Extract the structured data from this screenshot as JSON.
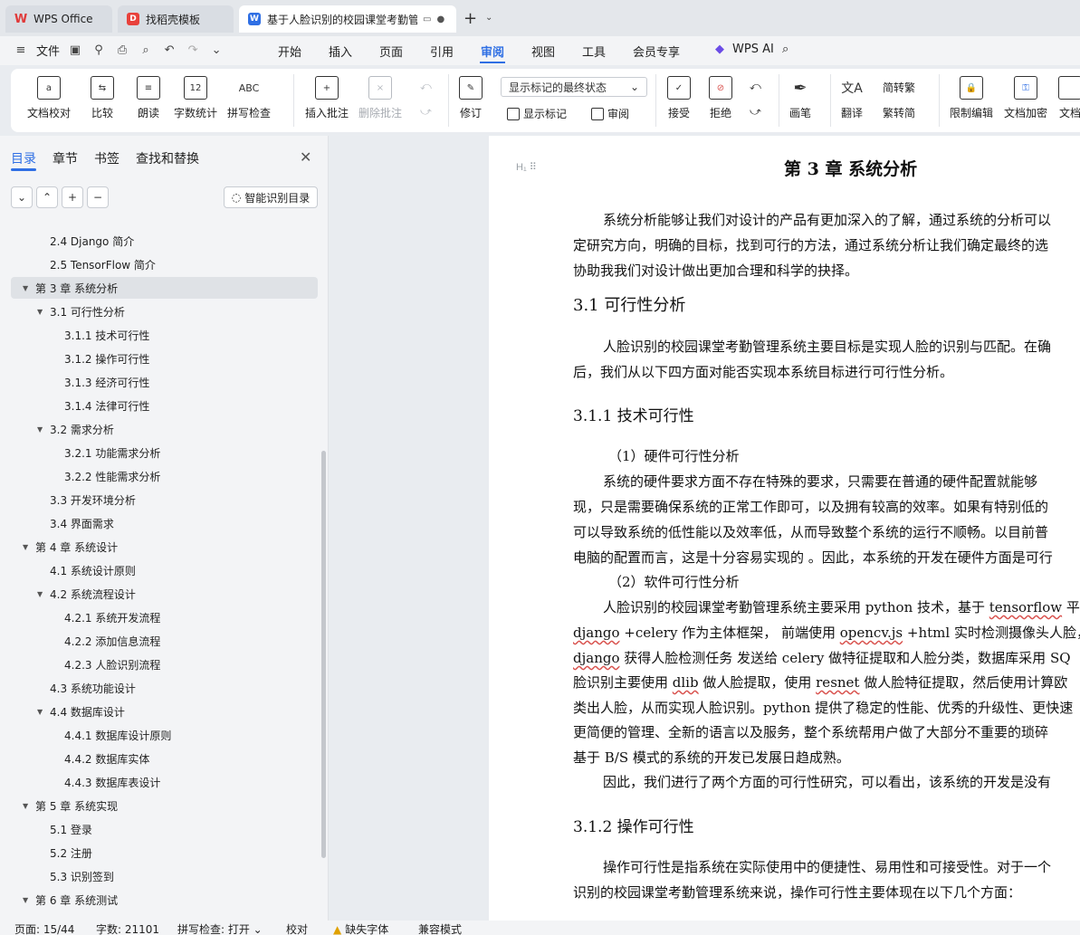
{
  "tabs": [
    {
      "label": "WPS Office",
      "icon": "wps-logo-icon"
    },
    {
      "label": "找稻壳模板",
      "icon": "daoke-icon"
    },
    {
      "label": "基于人脸识别的校园课堂考勤管理系统",
      "icon": "writer-doc-icon",
      "active": true
    }
  ],
  "menu": {
    "file_label": "文件",
    "items": [
      "开始",
      "插入",
      "页面",
      "引用",
      "审阅",
      "视图",
      "工具",
      "会员专享"
    ],
    "active": "审阅",
    "wps_ai_label": "WPS AI"
  },
  "ribbon": {
    "doc_check": "文档校对",
    "compare": "比较",
    "read_aloud": "朗读",
    "word_count": "字数统计",
    "spell_check": "拼写检查",
    "insert_comment": "插入批注",
    "delete_comment": "删除批注",
    "revise": "修订",
    "markup_state": "显示标记的最终状态",
    "show_markup": "显示标记",
    "review": "审阅",
    "accept": "接受",
    "reject": "拒绝",
    "pen": "画笔",
    "translate": "翻译",
    "to_traditional": "简转繁",
    "to_simplified": "繁转简",
    "restrict_edit": "限制编辑",
    "doc_encrypt": "文档加密",
    "doc_more": "文档",
    "word_count_glyph": "12",
    "spell_glyph": "ABC"
  },
  "nav": {
    "tabs": [
      "目录",
      "章节",
      "书签",
      "查找和替换"
    ],
    "active_tab": "目录",
    "smart_toc": "智能识别目录",
    "toc": [
      {
        "text": "2.4 Django 简介",
        "level": 2,
        "caret": false
      },
      {
        "text": "2.5 TensorFlow 简介",
        "level": 2,
        "caret": false
      },
      {
        "text": "第 3 章  系统分析",
        "level": 1,
        "caret": true,
        "selected": true
      },
      {
        "text": "3.1  可行性分析",
        "level": 2,
        "caret": true
      },
      {
        "text": "3.1.1  技术可行性",
        "level": 3,
        "caret": false
      },
      {
        "text": "3.1.2  操作可行性",
        "level": 3,
        "caret": false
      },
      {
        "text": "3.1.3  经济可行性",
        "level": 3,
        "caret": false
      },
      {
        "text": "3.1.4  法律可行性",
        "level": 3,
        "caret": false
      },
      {
        "text": "3.2 需求分析",
        "level": 2,
        "caret": true
      },
      {
        "text": "3.2.1  功能需求分析",
        "level": 3,
        "caret": false
      },
      {
        "text": "3.2.2  性能需求分析",
        "level": 3,
        "caret": false
      },
      {
        "text": "3.3 开发环境分析",
        "level": 2,
        "caret": false
      },
      {
        "text": "3.4 界面需求",
        "level": 2,
        "caret": false
      },
      {
        "text": "第 4 章  系统设计",
        "level": 1,
        "caret": true
      },
      {
        "text": "4.1 系统设计原则",
        "level": 2,
        "caret": false
      },
      {
        "text": "4.2 系统流程设计",
        "level": 2,
        "caret": true
      },
      {
        "text": "4.2.1 系统开发流程",
        "level": 3,
        "caret": false
      },
      {
        "text": "4.2.2  添加信息流程",
        "level": 3,
        "caret": false
      },
      {
        "text": "4.2.3  人脸识别流程",
        "level": 3,
        "caret": false
      },
      {
        "text": "4.3  系统功能设计",
        "level": 2,
        "caret": false
      },
      {
        "text": "4.4  数据库设计",
        "level": 2,
        "caret": true
      },
      {
        "text": "4.4.1  数据库设计原则",
        "level": 3,
        "caret": false
      },
      {
        "text": "4.4.2  数据库实体",
        "level": 3,
        "caret": false
      },
      {
        "text": "4.4.3  数据库表设计",
        "level": 3,
        "caret": false
      },
      {
        "text": "第 5 章  系统实现",
        "level": 1,
        "caret": true
      },
      {
        "text": "5.1  登录",
        "level": 2,
        "caret": false
      },
      {
        "text": "5.2  注册",
        "level": 2,
        "caret": false
      },
      {
        "text": "5.3  识别签到",
        "level": 2,
        "caret": false
      },
      {
        "text": "第 6 章  系统测试",
        "level": 1,
        "caret": true
      }
    ]
  },
  "doc": {
    "heading_handle": "H₁ ⠿",
    "title": "第 3 章  系统分析",
    "intro": [
      "系统分析能够让我们对设计的产品有更加深入的了解，通过系统的分析可以",
      "定研究方向，明确的目标，找到可行的方法，通过系统分析让我们确定最终的选",
      "协助我我们对设计做出更加合理和科学的抉择。"
    ],
    "h_3_1": "3.1  可行性分析",
    "p_3_1": [
      "人脸识别的校园课堂考勤管理系统主要目标是实现人脸的识别与匹配。在确",
      "后，我们从以下四方面对能否实现本系统目标进行可行性分析。"
    ],
    "h_3_1_1": "3.1.1  技术可行性",
    "hw_label": "（1）硬件可行性分析",
    "hw": [
      "系统的硬件要求方面不存在特殊的要求，只需要在普通的硬件配置就能够",
      "现，只是需要确保系统的正常工作即可，以及拥有较高的效率。如果有特别低的",
      "可以导致系统的低性能以及效率低，从而导致整个系统的运行不顺畅。以目前普",
      "电脑的配置而言，这是十分容易实现的 。因此，本系统的开发在硬件方面是可行"
    ],
    "sw_label": "（2）软件可行性分析",
    "sw": [
      [
        "人脸识别的校园课堂考勤管理系统主要采用 python 技术，基于 ",
        "tensorflow",
        " 平"
      ],
      [
        "",
        "django",
        " +celery 作为主体框架， 前端使用 ",
        "opencv.js",
        " +html 实时检测摄像头人脸，"
      ],
      [
        "",
        "django",
        " 获得人脸检测任务 发送给 celery 做特征提取和人脸分类，数据库采用 SQ"
      ],
      [
        "脸识别主要使用 ",
        "dlib",
        " 做人脸提取，使用 ",
        "resnet",
        " 做人脸特征提取，然后使用计算欧"
      ]
    ],
    "sw_more": [
      "类出人脸，从而实现人脸识别。python 提供了稳定的性能、优秀的升级性、更快速",
      "更简便的管理、全新的语言以及服务，整个系统帮用户做了大部分不重要的琐碎",
      "基于 B/S 模式的系统的开发已发展日趋成熟。"
    ],
    "conclusion": "因此，我们进行了两个方面的可行性研究，可以看出，该系统的开发是没有",
    "h_3_1_2": "3.1.2  操作可行性",
    "p_3_1_2": [
      "操作可行性是指系统在实际使用中的便捷性、易用性和可接受性。对于一个",
      "识别的校园课堂考勤管理系统来说，操作可行性主要体现在以下几个方面："
    ]
  },
  "status": {
    "page": "页面: 15/44",
    "words": "字数: 21101",
    "spell": "拼写检查: 打开",
    "proof": "校对",
    "missing_font": "缺失字体",
    "compat": "兼容模式"
  }
}
